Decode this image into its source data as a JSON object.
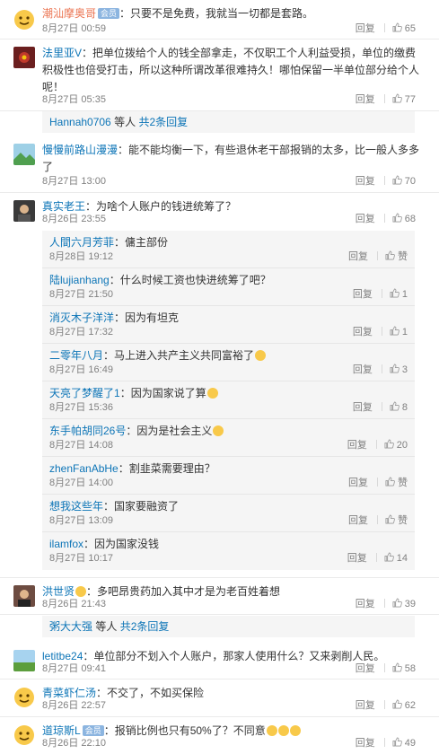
{
  "ui": {
    "reply_label": "回复",
    "like_default": "赞",
    "more_suffix_etc": "等人",
    "more_total": "共2条回复"
  },
  "comments": [
    {
      "user": "潮汕摩奥哥",
      "vip": "会员",
      "text": "：只要不是免费，我就当一切都是套路。",
      "time": "8月27日 00:59",
      "likes": "65",
      "avatar": "smiley-avatar"
    },
    {
      "user": "法里亚V",
      "text": "：把单位拨给个人的钱全部拿走，不仅职工个人利益受损，单位的缴费积极性也倍受打击，所以这种所谓改革很难持久！哪怕保留一半单位部分给个人呢！",
      "time": "8月27日 05:35",
      "likes": "77",
      "avatar": "red-flower-avatar"
    },
    {
      "more_user": "Hannah0706"
    },
    {
      "user": "慢慢前路山漫漫",
      "text": "：能不能均衡一下，有些退休老干部报销的太多，比一般人多多了",
      "time": "8月27日 13:00",
      "likes": "70",
      "avatar": "landscape-avatar"
    },
    {
      "user": "真实老王",
      "text": "：为啥个人账户的钱进统筹了？",
      "time": "8月26日 23:55",
      "likes": "68",
      "avatar": "man-avatar"
    },
    {
      "more_user": "洪世贤"
    },
    {
      "user": "letitbe24",
      "text": "：单位部分不划入个人账户，那家人使用什么？又来剥削人民。",
      "time": "8月27日 09:41",
      "likes": "58",
      "avatar": "green-field-avatar"
    },
    {
      "user": "青菜虾仁汤",
      "text": "：不交了，不如买保险",
      "time": "8月26日 22:57",
      "likes": "62",
      "avatar": "smiley-avatar"
    },
    {
      "user": "道琼斯L",
      "vip": "会员",
      "text": "：报销比例也只有50%了？不同意",
      "time": "8月26日 22:10",
      "likes": "49",
      "avatar": "smiley-avatar"
    }
  ],
  "replies": [
    {
      "user": "人間六月芳菲",
      "text": "：傭主部份",
      "time": "8月28日 19:12",
      "likes": "赞"
    },
    {
      "user": "陆lujianhang",
      "text": "：什么时候工资也快进统筹了吧？",
      "time": "8月27日 21:50",
      "likes": "1"
    },
    {
      "user": "消灭木子洋洋",
      "text": "：因为有坦克",
      "time": "8月27日 17:32",
      "likes": "1"
    },
    {
      "user": "二零年八月",
      "text": "：马上进入共产主义共同富裕了",
      "time": "8月27日 16:49",
      "likes": "3"
    },
    {
      "user": "天亮了梦醒了1",
      "text": "：因为国家说了算",
      "time": "8月27日 15:36",
      "likes": "8"
    },
    {
      "user": "东手帕胡同26号",
      "text": "：因为是社会主义",
      "time": "8月27日 14:08",
      "likes": "20"
    },
    {
      "user": "zhenFanAbHe",
      "text": "：割韭菜需要理由？",
      "time": "8月27日 14:00",
      "likes": "赞"
    },
    {
      "user": "想我这些年",
      "text": "：国家要融资了",
      "time": "8月27日 13:09",
      "likes": "赞"
    },
    {
      "user": "ilamfox",
      "text": "：因为国家没钱",
      "time": "8月27日 10:17",
      "likes": "14"
    }
  ],
  "c6": {
    "user": "洪世贤",
    "text": "：多吧昂贵药加入其中才是为老百姓着想",
    "time": "8月26日 21:43",
    "likes": "39"
  },
  "more2_user": "粥大大强"
}
